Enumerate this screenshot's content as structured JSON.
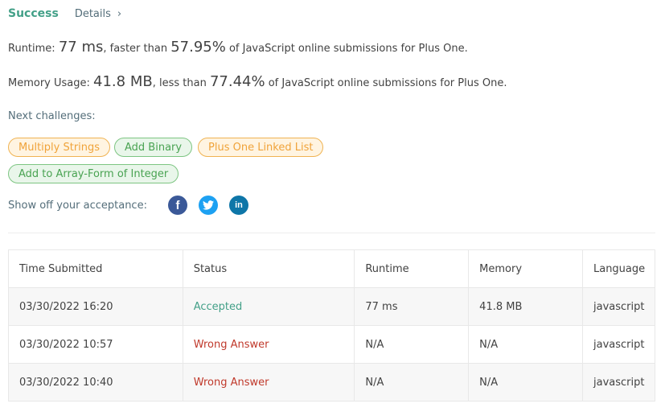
{
  "header": {
    "status": "Success",
    "details_label": "Details",
    "details_chevron": "›"
  },
  "runtime": {
    "label": "Runtime: ",
    "value": "77 ms",
    "mid": ", faster than ",
    "percent": "57.95%",
    "suffix": " of JavaScript online submissions for Plus One."
  },
  "memory": {
    "label": "Memory Usage: ",
    "value": "41.8 MB",
    "mid": ", less than ",
    "percent": "77.44%",
    "suffix": " of JavaScript online submissions for Plus One."
  },
  "next_challenges": {
    "label": "Next challenges:",
    "items": [
      {
        "label": "Multiply Strings",
        "difficulty": "medium"
      },
      {
        "label": "Add Binary",
        "difficulty": "easy"
      },
      {
        "label": "Plus One Linked List",
        "difficulty": "medium"
      },
      {
        "label": "Add to Array-Form of Integer",
        "difficulty": "easy"
      }
    ]
  },
  "share": {
    "label": "Show off your acceptance:",
    "facebook": {
      "glyph": "f",
      "color": "#3b5998"
    },
    "twitter": {
      "glyph": "🐦",
      "color": "#1da1f2"
    },
    "linkedin": {
      "glyph": "in",
      "color": "#0e76a8"
    }
  },
  "colors": {
    "accent": "#43a088",
    "wrong": "#c0392b",
    "medium": "#f0a33a",
    "easy": "#49a352"
  },
  "table": {
    "headers": [
      "Time Submitted",
      "Status",
      "Runtime",
      "Memory",
      "Language"
    ],
    "rows": [
      {
        "time": "03/30/2022 16:20",
        "status": "Accepted",
        "runtime": "77 ms",
        "memory": "41.8 MB",
        "language": "javascript"
      },
      {
        "time": "03/30/2022 10:57",
        "status": "Wrong Answer",
        "runtime": "N/A",
        "memory": "N/A",
        "language": "javascript"
      },
      {
        "time": "03/30/2022 10:40",
        "status": "Wrong Answer",
        "runtime": "N/A",
        "memory": "N/A",
        "language": "javascript"
      }
    ]
  }
}
